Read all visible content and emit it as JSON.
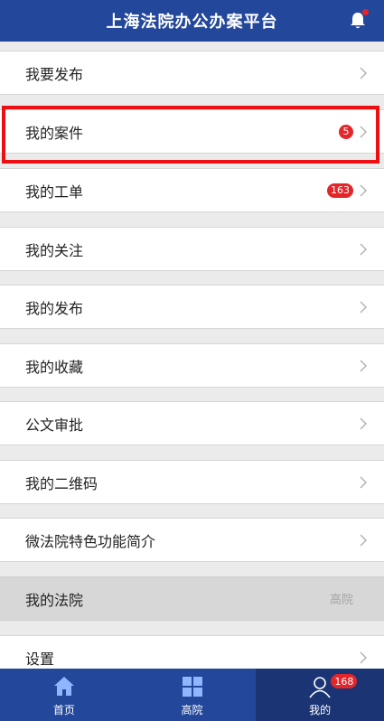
{
  "header": {
    "title": "上海法院办公办案平台",
    "bell_icon": "bell-icon",
    "has_notification_dot": true
  },
  "menu": [
    {
      "label": "我要发布"
    },
    {
      "label": "我的案件",
      "badge": "5",
      "highlighted": true
    },
    {
      "label": "我的工单",
      "badge": "163"
    },
    {
      "label": "我的关注"
    },
    {
      "label": "我的发布"
    },
    {
      "label": "我的收藏"
    },
    {
      "label": "公文审批"
    },
    {
      "label": "我的二维码"
    },
    {
      "label": "微法院特色功能简介"
    },
    {
      "label": "我的法院",
      "value": "高院"
    },
    {
      "label": "设置"
    }
  ],
  "tabbar": {
    "tabs": [
      {
        "label": "首页",
        "icon": "home-icon"
      },
      {
        "label": "高院",
        "icon": "grid-icon"
      },
      {
        "label": "我的",
        "icon": "user-icon",
        "badge": "168",
        "active": true
      }
    ]
  },
  "colors": {
    "primary": "#23479a",
    "badge": "#e3262a",
    "highlight": "#ee0f13"
  }
}
